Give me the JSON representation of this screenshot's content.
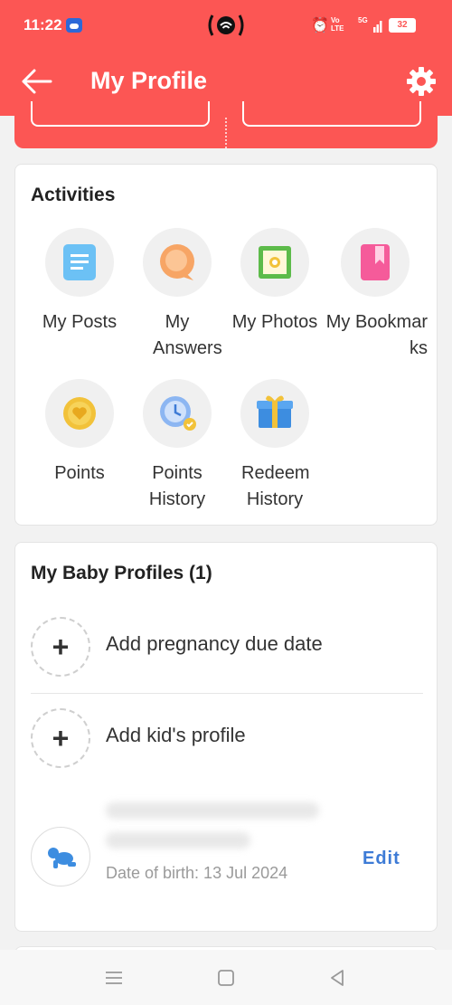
{
  "status_bar": {
    "time": "11:22",
    "volte_top": "Vo",
    "volte_bottom": "LTE",
    "signal": "5G",
    "battery": "32"
  },
  "header": {
    "title": "My Profile"
  },
  "activities": {
    "title": "Activities",
    "items": [
      {
        "label": "My Posts",
        "icon": "document-icon"
      },
      {
        "label": "My Answers",
        "icon": "chat-bubble-icon"
      },
      {
        "label": "My Photos",
        "icon": "photo-icon"
      },
      {
        "label": "My Bookmarks",
        "icon": "bookmark-icon"
      },
      {
        "label": "Points",
        "icon": "coin-icon"
      },
      {
        "label": "Points History",
        "icon": "clock-history-icon"
      },
      {
        "label": "Redeem History",
        "icon": "gift-icon"
      }
    ]
  },
  "baby_profiles": {
    "title": "My Baby Profiles (1)",
    "add_due_date": "Add pregnancy due date",
    "add_kid": "Add kid's profile",
    "kid": {
      "dob": "Date of birth: 13 Jul 2024",
      "edit": "Edit"
    }
  },
  "colors": {
    "accent": "#fc5654",
    "link": "#3d7bd6"
  }
}
